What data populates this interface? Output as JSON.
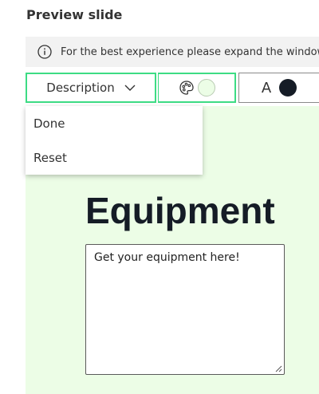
{
  "header": {
    "title": "Preview slide"
  },
  "info_bar": {
    "icon": "info-icon",
    "message": "For the best experience please expand the window"
  },
  "toolbar": {
    "layout_select_label": "Description",
    "background_color_icon": "palette-icon",
    "background_color": "#ecfde6",
    "text_color_label": "A",
    "text_color": "#151c26",
    "accent_color": "#3ddc84"
  },
  "dropdown": {
    "items": [
      {
        "label": "Done"
      },
      {
        "label": "Reset"
      }
    ]
  },
  "slide": {
    "title": "Equipment",
    "description": "Get your equipment here!"
  }
}
